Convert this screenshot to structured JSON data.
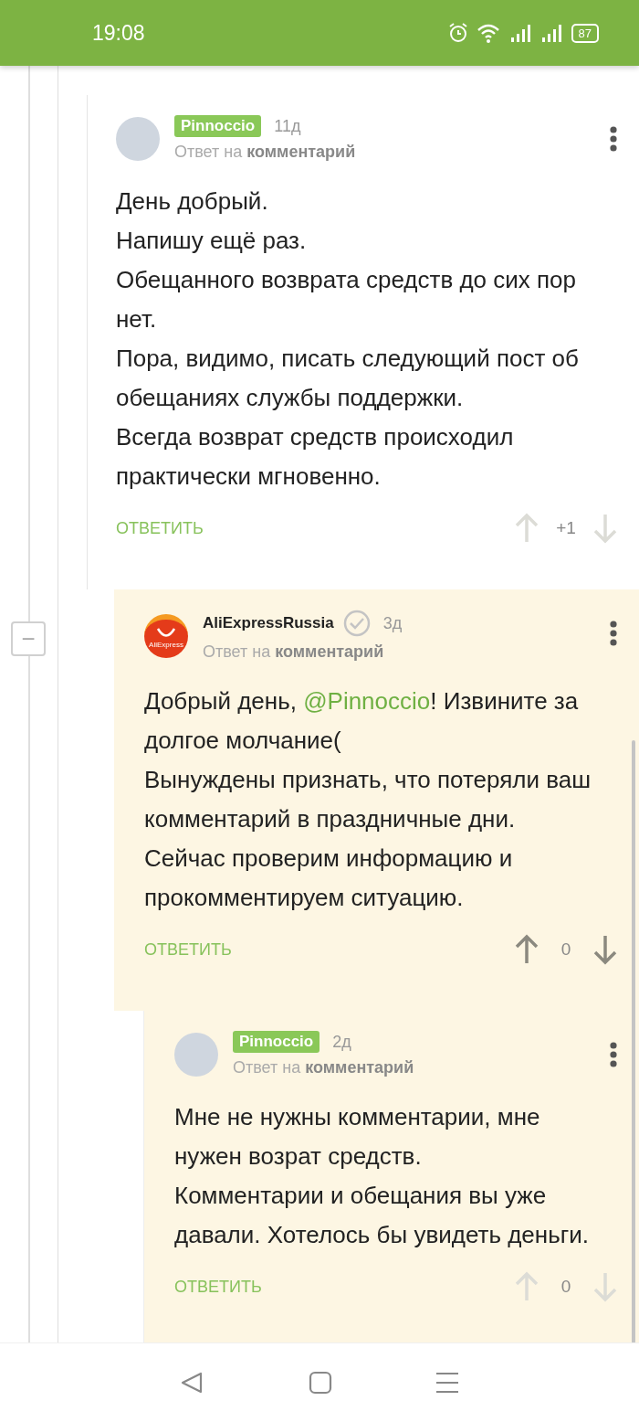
{
  "status_bar": {
    "time": "19:08",
    "battery": "87"
  },
  "comments": [
    {
      "author": {
        "name": "Pinnoccio",
        "kind": "badge"
      },
      "verified": false,
      "avatar": {
        "kind": "photo"
      },
      "age": "11д",
      "reply_to": "Ответ на **комментарий**",
      "highlighted": false,
      "paragraphs": [
        [
          {
            "kind": "plain",
            "text": "День добрый."
          }
        ],
        [
          {
            "kind": "plain",
            "text": "Напишу ещё раз."
          }
        ],
        [
          {
            "kind": "plain",
            "text": "Обещанного возврата средств до сих пор нет."
          }
        ],
        [
          {
            "kind": "plain",
            "text": "Пора, видимо, писать следующий пост об обещаниях службы поддержки."
          }
        ],
        [
          {
            "kind": "plain",
            "text": "Всегда возврат средств происходил практически мгновенно."
          }
        ]
      ],
      "reply": "ОТВЕТИТЬ",
      "score": "+1",
      "voting_enabled": false,
      "children": [
        {
          "author": {
            "name": "AliExpressRussia",
            "kind": "plain"
          },
          "verified": true,
          "avatar": {
            "kind": "logo",
            "label": "AliExpress"
          },
          "age": "3д",
          "reply_to": "Ответ на **комментарий**",
          "highlighted": true,
          "collapse": "−",
          "paragraphs": [
            [
              {
                "kind": "plain",
                "text": "Добрый день, "
              },
              {
                "kind": "mention",
                "text": "@Pinnoccio"
              },
              {
                "kind": "plain",
                "text": "! Извините за долгое молчание("
              }
            ],
            [
              {
                "kind": "plain",
                "text": "Вынуждены признать, что потеряли ваш комментарий в праздничные дни. Сейчас проверим информацию и прокомментируем ситуацию."
              }
            ]
          ],
          "reply": "ОТВЕТИТЬ",
          "score": "0",
          "voting_enabled": true,
          "children": [
            {
              "author": {
                "name": "Pinnoccio",
                "kind": "badge"
              },
              "verified": false,
              "avatar": {
                "kind": "photo"
              },
              "age": "2д",
              "reply_to": "Ответ на **комментарий**",
              "highlighted": true,
              "paragraphs": [
                [
                  {
                    "kind": "plain",
                    "text": "Мне не нужны комментарии, мне нужен возрат средств."
                  }
                ],
                [
                  {
                    "kind": "plain",
                    "text": "Комментарии и обещания вы уже давали. Хотелось бы увидеть деньги."
                  }
                ]
              ],
              "reply": "ОТВЕТИТЬ",
              "score": "0",
              "voting_enabled": false
            }
          ]
        }
      ]
    }
  ]
}
